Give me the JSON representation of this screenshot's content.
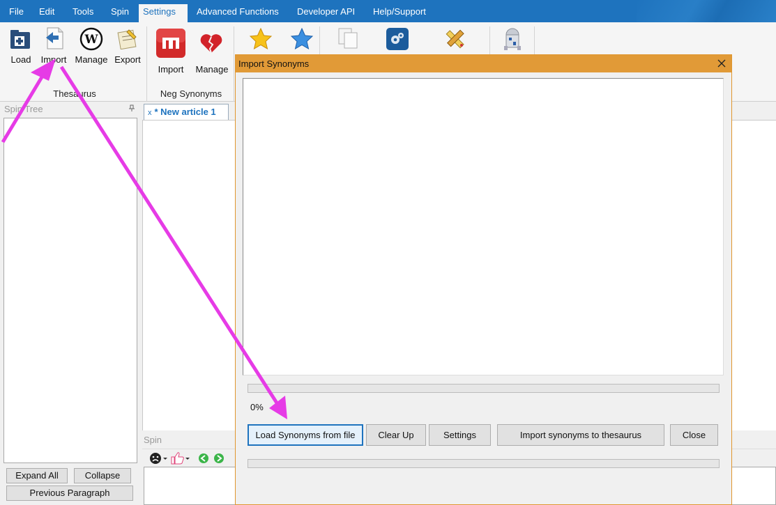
{
  "menu": {
    "items": [
      "File",
      "Edit",
      "Tools",
      "Spin",
      "Settings",
      "Advanced Functions",
      "Developer API",
      "Help/Support"
    ],
    "active": "Settings"
  },
  "ribbon": {
    "thesaurus": {
      "group_label": "Thesaurus",
      "buttons": [
        {
          "label": "Load",
          "icon": "folder-plus-icon"
        },
        {
          "label": "Import",
          "icon": "import-document-icon"
        },
        {
          "label": "Manage",
          "icon": "wordpress-w-icon"
        },
        {
          "label": "Export",
          "icon": "export-notepad-icon"
        }
      ]
    },
    "neg_synonyms": {
      "group_label": "Neg Synonyms",
      "buttons": [
        {
          "label": "Import",
          "icon": "red-m-icon"
        },
        {
          "label": "Manage",
          "icon": "broken-heart-icon"
        }
      ]
    },
    "more_icons": [
      "gold-star-icon",
      "blue-star-icon",
      "copy-pages-icon",
      "gears-icon",
      "pencil-ruler-icon",
      "robot-icon"
    ]
  },
  "left_panel": {
    "title": "Spin Tree",
    "expand_all": "Expand All",
    "collapse": "Collapse",
    "previous_paragraph": "Previous Paragraph"
  },
  "editor": {
    "tab_close": "x",
    "tab_label": "* New article 1",
    "spin_title": "Spin"
  },
  "dialog": {
    "title": "Import Synonyms",
    "progress_text": "0%",
    "progress_value": 0,
    "buttons": {
      "load": "Load Synonyms from file",
      "clear": "Clear Up",
      "settings": "Settings",
      "import": "Import synonyms to thesaurus",
      "close": "Close"
    }
  },
  "colors": {
    "menubar": "#1e73be",
    "dialog_title": "#e19a37",
    "annotation": "#e63be6"
  }
}
